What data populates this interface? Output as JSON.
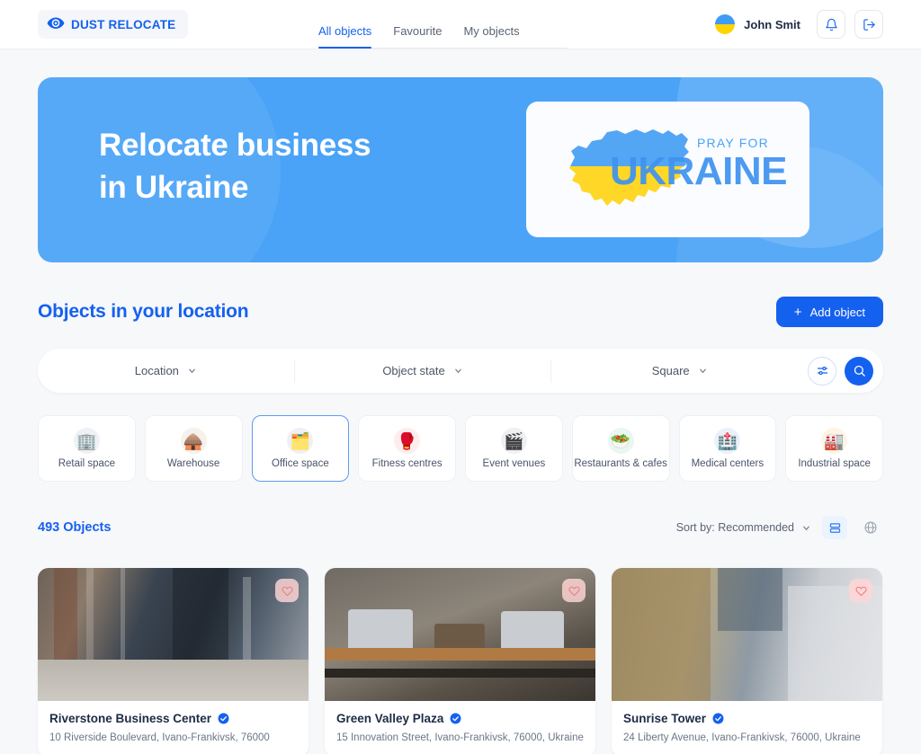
{
  "brand": {
    "name": "DUST RELOCATE",
    "accent": "#1461f0"
  },
  "nav": {
    "tabs": [
      {
        "label": "All objects",
        "active": true
      },
      {
        "label": "Favourite",
        "active": false
      },
      {
        "label": "My objects",
        "active": false
      }
    ]
  },
  "user": {
    "name": "John Smit"
  },
  "header_actions": {
    "notifications": "bell-icon",
    "logout": "logout-icon"
  },
  "banner": {
    "title_line1": "Relocate business",
    "title_line2": "in Ukraine",
    "card": {
      "pray_for": "PRAY FOR",
      "ukraine": "UKRAINE"
    },
    "bg_color": "#4aa3f7"
  },
  "section": {
    "title": "Objects in your location",
    "add_label": "Add object",
    "add_plus": "+"
  },
  "filters": {
    "location": "Location",
    "object_state": "Object state",
    "square": "Square",
    "tune_icon": "filter-sliders-icon",
    "search_icon": "search-icon"
  },
  "categories": [
    {
      "label": "Retail space",
      "emoji": "🏢",
      "bg": "#eef1f6",
      "active": false
    },
    {
      "label": "Warehouse",
      "emoji": "🛖",
      "bg": "#f6f1ea",
      "active": false
    },
    {
      "label": "Office space",
      "emoji": "🗂️",
      "bg": "#eef0f3",
      "active": true
    },
    {
      "label": "Fitness centres",
      "emoji": "🥊",
      "bg": "#fdeeee",
      "active": false
    },
    {
      "label": "Event venues",
      "emoji": "🎬",
      "bg": "#eef0f3",
      "active": false
    },
    {
      "label": "Restaurants & cafes",
      "emoji": "🥗",
      "bg": "#e9f6f2",
      "active": false
    },
    {
      "label": "Medical centers",
      "emoji": "🏥",
      "bg": "#eaf1fa",
      "active": false
    },
    {
      "label": "Industrial space",
      "emoji": "🏭",
      "bg": "#fdf4e4",
      "active": false
    }
  ],
  "results": {
    "count_label": "493 Objects",
    "sort_label": "Sort by: Recommended",
    "view_list": "list-view-icon",
    "view_map": "map-globe-icon"
  },
  "cards": [
    {
      "title": "Riverstone Business Center",
      "address": "10 Riverside Boulevard, Ivano-Frankivsk, 76000",
      "verified": true,
      "favourite": false
    },
    {
      "title": "Green Valley Plaza",
      "address": "15 Innovation Street, Ivano-Frankivsk, 76000, Ukraine",
      "verified": true,
      "favourite": false
    },
    {
      "title": "Sunrise Tower",
      "address": "24 Liberty Avenue, Ivano-Frankivsk, 76000, Ukraine",
      "verified": true,
      "favourite": false
    }
  ]
}
